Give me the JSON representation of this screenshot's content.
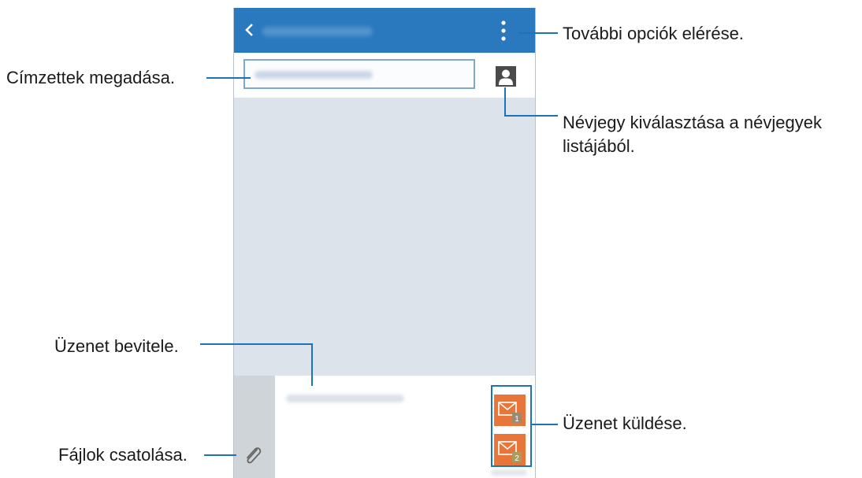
{
  "callouts": {
    "more_options": "További opciók elérése.",
    "recipients": "Címzettek megadása.",
    "contact_pick": "Névjegy kiválasztása a névjegyek listájából.",
    "message_entry": "Üzenet bevitele.",
    "send_message": "Üzenet küldése.",
    "attach_files": "Fájlok csatolása."
  },
  "send_buttons": [
    {
      "sim": "1"
    },
    {
      "sim": "2"
    }
  ],
  "colors": {
    "appbar": "#2a78bd",
    "background": "#dde3ea",
    "send_button": "#e8763a",
    "leader_line": "#1d73b7"
  }
}
